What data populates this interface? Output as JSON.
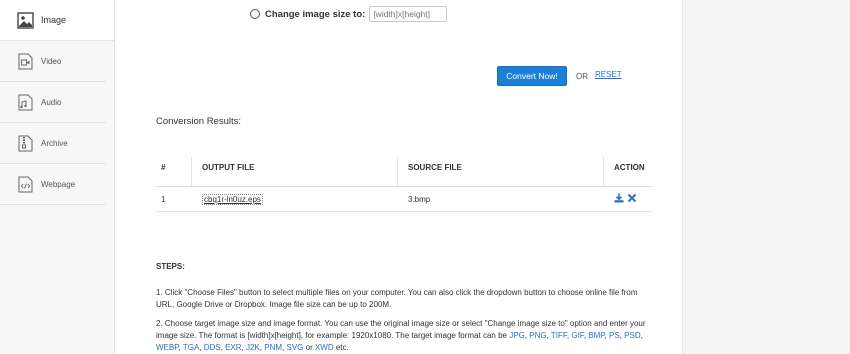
{
  "sidebar": {
    "items": [
      {
        "label": "Image",
        "icon": "image-icon",
        "active": true
      },
      {
        "label": "Video",
        "icon": "video-icon",
        "active": false
      },
      {
        "label": "Audio",
        "icon": "audio-icon",
        "active": false
      },
      {
        "label": "Archive",
        "icon": "archive-icon",
        "active": false
      },
      {
        "label": "Webpage",
        "icon": "webpage-icon",
        "active": false
      }
    ]
  },
  "resize": {
    "label": "Change image size to:",
    "placeholder": "[width]x[height]"
  },
  "actions": {
    "convert_label": "Convert Now!",
    "or_label": "OR",
    "reset_label": "RESET"
  },
  "results": {
    "title": "Conversion Results:",
    "columns": [
      "#",
      "OUTPUT FILE",
      "SOURCE FILE",
      "ACTION"
    ],
    "rows": [
      {
        "num": "1",
        "output": "cbq1r-ln0uz.eps",
        "source": "3.bmp"
      }
    ]
  },
  "steps": {
    "title": "STEPS:",
    "step1": "1. Click \"Choose Files\" button to select multiple files on your computer. You can also click the dropdown button to choose online file from URL, Google Drive or Dropbox. Image file size can be up to 200M.",
    "step2_intro": "2. Choose target image size and image format. You can use the original image size or select \"Change image size to\" option and enter your image size. The format is [width]x[height], for example: 1920x1080. The target image format can be ",
    "formats": [
      "JPG",
      "PNG",
      "TIFF",
      "GIF",
      "BMP",
      "PS",
      "PSD",
      "WEBP",
      "TGA",
      "DDS",
      "EXR",
      "J2K",
      "PNM",
      "SVG"
    ],
    "last_format": "XWD",
    "or_word": " or ",
    "etc": " etc."
  },
  "colors": {
    "accent": "#1d80d8",
    "link": "#2a6fc4",
    "sidebar_bg": "#f7f7f7"
  }
}
